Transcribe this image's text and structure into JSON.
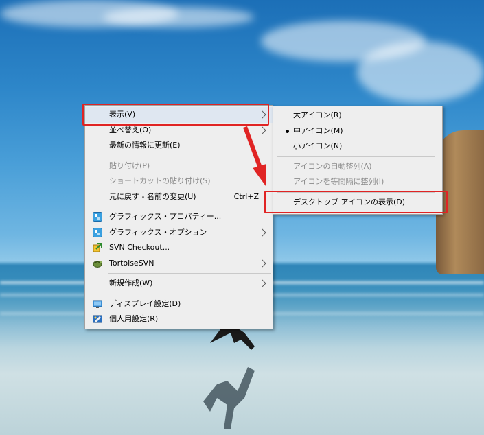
{
  "context_menu": {
    "items": [
      {
        "label": "表示(V)",
        "has_submenu": true
      },
      {
        "label": "並べ替え(O)",
        "has_submenu": true
      },
      {
        "label": "最新の情報に更新(E)"
      },
      {
        "label": "貼り付け(P)",
        "disabled": true
      },
      {
        "label": "ショートカットの貼り付け(S)",
        "disabled": true
      },
      {
        "label": "元に戻す - 名前の変更(U)",
        "shortcut": "Ctrl+Z"
      },
      {
        "label": "グラフィックス・プロパティー...",
        "icon": "intel-graphics-icon"
      },
      {
        "label": "グラフィックス・オプション",
        "icon": "intel-graphics-icon",
        "has_submenu": true
      },
      {
        "label": "SVN Checkout...",
        "icon": "svn-checkout-icon"
      },
      {
        "label": "TortoiseSVN",
        "icon": "tortoise-svn-icon",
        "has_submenu": true
      },
      {
        "label": "新規作成(W)",
        "has_submenu": true
      },
      {
        "label": "ディスプレイ設定(D)",
        "icon": "display-settings-icon"
      },
      {
        "label": "個人用設定(R)",
        "icon": "personalize-icon"
      }
    ]
  },
  "view_submenu": {
    "items": [
      {
        "label": "大アイコン(R)"
      },
      {
        "label": "中アイコン(M)",
        "selected": true
      },
      {
        "label": "小アイコン(N)"
      },
      {
        "label": "アイコンの自動整列(A)",
        "disabled": true
      },
      {
        "label": "アイコンを等間隔に整列(I)",
        "disabled": true
      },
      {
        "label": "デスクトップ アイコンの表示(D)"
      }
    ]
  },
  "annotations": {
    "highlight_color": "#e02424",
    "arrow_color": "#e02424"
  }
}
